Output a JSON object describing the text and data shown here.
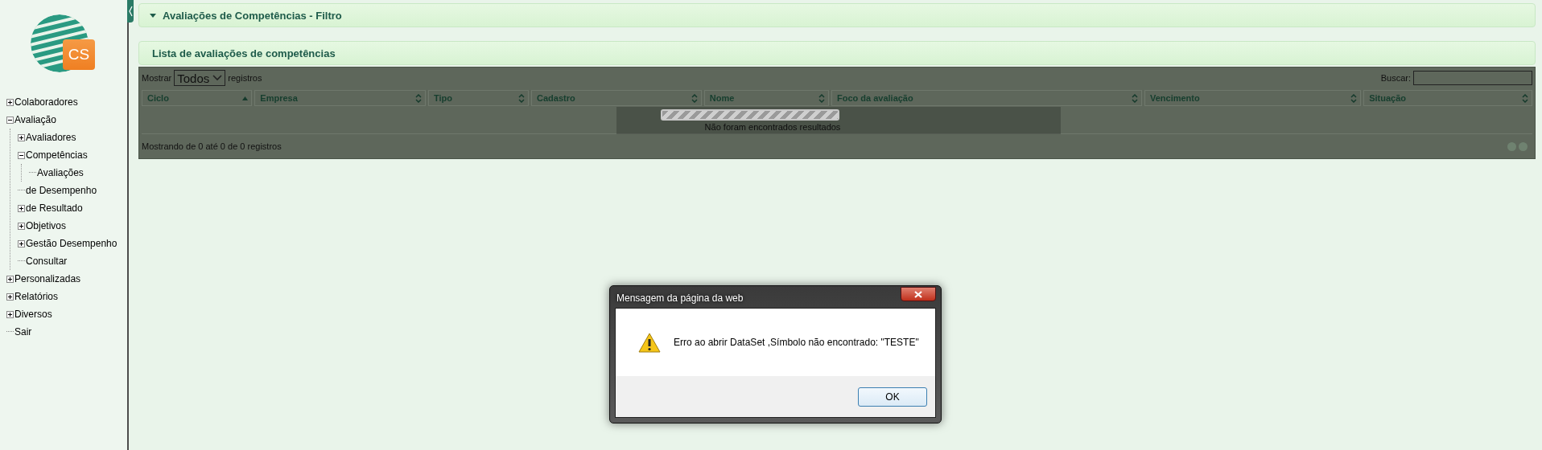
{
  "logo": {
    "text": "CS"
  },
  "sidebar": {
    "tree": [
      {
        "label": "Colaboradores",
        "kind": "node",
        "expanded": false
      },
      {
        "label": "Avaliação",
        "kind": "node",
        "expanded": true,
        "children": [
          {
            "label": "Avaliadores",
            "kind": "node",
            "expanded": false
          },
          {
            "label": "Competências",
            "kind": "node",
            "expanded": true,
            "children": [
              {
                "label": "Avaliações",
                "kind": "leaf"
              }
            ]
          },
          {
            "label": "de Desempenho",
            "kind": "leaf"
          },
          {
            "label": "de Resultado",
            "kind": "node",
            "expanded": false
          },
          {
            "label": "Objetivos",
            "kind": "node",
            "expanded": false
          },
          {
            "label": "Gestão Desempenho",
            "kind": "node",
            "expanded": false
          },
          {
            "label": "Consultar",
            "kind": "leaf"
          }
        ]
      },
      {
        "label": "Personalizadas",
        "kind": "node",
        "expanded": false
      },
      {
        "label": "Relatórios",
        "kind": "node",
        "expanded": false
      },
      {
        "label": "Diversos",
        "kind": "node",
        "expanded": false
      },
      {
        "label": "Sair",
        "kind": "leaf"
      }
    ]
  },
  "filter_panel": {
    "title": "Avaliações de Competências - Filtro",
    "expanded": true
  },
  "list_panel": {
    "title": "Lista de avaliações de competências",
    "table": {
      "show_label": "Mostrar",
      "page_size": "Todos",
      "records_label": "registros",
      "search_label": "Buscar:",
      "columns": [
        {
          "label": "Ciclo",
          "sorted": true
        },
        {
          "label": "Empresa",
          "sorted": false
        },
        {
          "label": "Tipo",
          "sorted": false
        },
        {
          "label": "Cadastro",
          "sorted": false
        },
        {
          "label": "Nome",
          "sorted": false
        },
        {
          "label": "Foco da avaliação",
          "sorted": false
        },
        {
          "label": "Vencimento",
          "sorted": false
        },
        {
          "label": "Situação",
          "sorted": false
        }
      ],
      "loading": true,
      "empty_message": "Não foram encontrados resultados",
      "info": "Mostrando de 0 até 0 de 0 registros"
    }
  },
  "dialog": {
    "title": "Mensagem da página da web",
    "message": "Erro ao abrir DataSet ,Símbolo não encontrado: \"TESTE\"",
    "buttons": [
      "OK"
    ]
  }
}
